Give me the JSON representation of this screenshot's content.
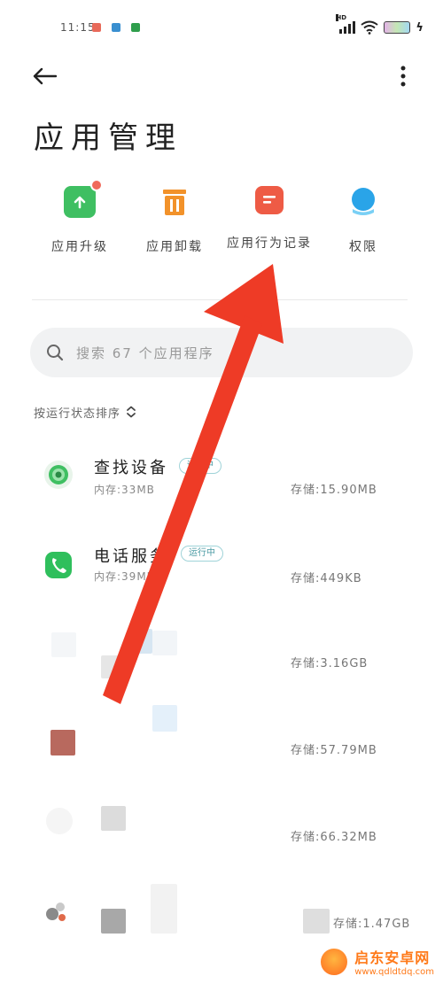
{
  "status_bar": {
    "time": "11:15",
    "network": "HD"
  },
  "header": {
    "title": "应用管理"
  },
  "quick_actions": [
    {
      "label": "应用升级",
      "icon": "upgrade-icon",
      "color": "#3fbf62"
    },
    {
      "label": "应用卸载",
      "icon": "trash-icon",
      "color": "#f2922a"
    },
    {
      "label": "应用行为记录",
      "icon": "record-icon",
      "color": "#ee5b45"
    },
    {
      "label": "权限",
      "icon": "shield-icon",
      "color": "#2aa4e8"
    }
  ],
  "search": {
    "placeholder": "搜索 67 个应用程序"
  },
  "sort": {
    "label": "按运行状态排序"
  },
  "apps": [
    {
      "name": "查找设备",
      "memory": "内存:33MB",
      "tag": "运行中",
      "storage": "存储:15.90MB"
    },
    {
      "name": "电话服务",
      "memory": "内存:39MB",
      "tag": "运行中",
      "storage": "存储:449KB"
    },
    {
      "storage": "存储:3.16GB"
    },
    {
      "storage": "存储:57.79MB"
    },
    {
      "storage": "存储:66.32MB"
    },
    {
      "storage": "存储:1.47GB"
    }
  ],
  "colors": {
    "arrow": "#ee3b26",
    "accent_tag": "#4a9aa3"
  },
  "watermark": {
    "name": "启东安卓网",
    "url": "www.qdldtdq.com"
  }
}
